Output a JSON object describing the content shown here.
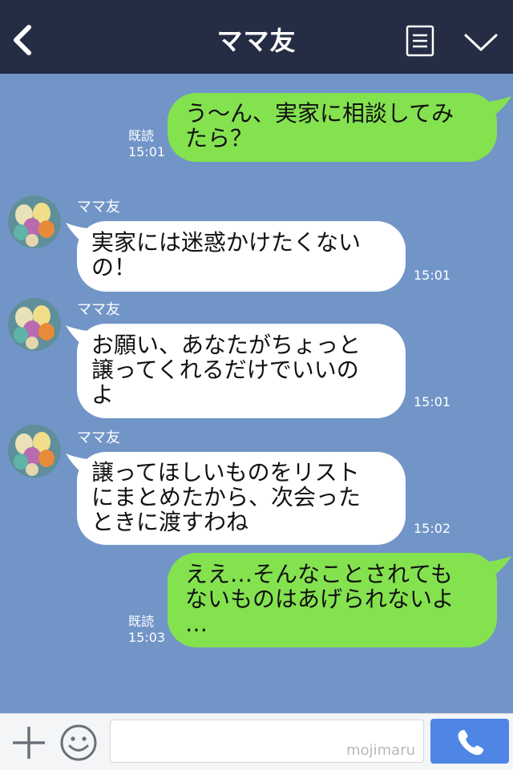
{
  "header": {
    "title": "ママ友"
  },
  "icons": {
    "back": "chevron-left-icon",
    "menu": "document-menu-icon",
    "collapse": "chevron-down-icon",
    "plus": "plus-icon",
    "emoji": "smiley-icon",
    "call": "phone-icon"
  },
  "messages": [
    {
      "side": "me",
      "lines": [
        "う〜ん、実家に相談してみ",
        "たら？"
      ],
      "read": "既読",
      "time": "15:01"
    },
    {
      "side": "them",
      "sender": "ママ友",
      "lines": [
        "実家には迷惑かけたくない",
        "の！"
      ],
      "time": "15:01"
    },
    {
      "side": "them",
      "sender": "ママ友",
      "lines": [
        "お願い、あなたがちょっと",
        "譲ってくれるだけでいいの",
        "よ"
      ],
      "time": "15:01"
    },
    {
      "side": "them",
      "sender": "ママ友",
      "lines": [
        "譲ってほしいものをリスト",
        "にまとめたから、次会った",
        "ときに渡すわね"
      ],
      "time": "15:02"
    },
    {
      "side": "me",
      "lines": [
        "ええ…そんなことされても",
        "ないものはあげられないよ",
        "…"
      ],
      "read": "既読",
      "time": "15:03"
    }
  ],
  "input": {
    "watermark": "mojimaru"
  },
  "colors": {
    "header_bg": "#252d44",
    "chat_bg": "#7295c8",
    "my_bubble": "#84e24f",
    "their_bubble": "#ffffff",
    "call_button": "#4f86e6"
  }
}
